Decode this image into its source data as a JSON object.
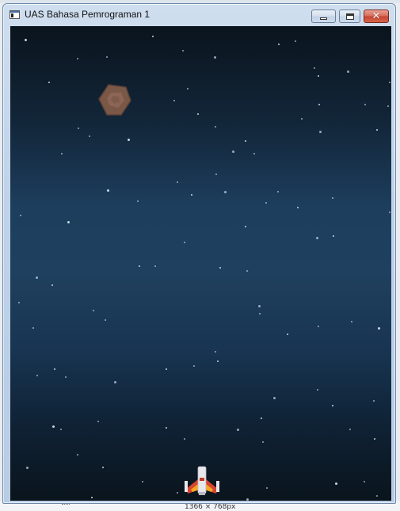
{
  "window": {
    "title": "UAS Bahasa Pemrograman 1",
    "controls": [
      "minimize",
      "maximize",
      "close"
    ]
  },
  "background_status": "1366 × 768px",
  "game": {
    "background": "starfield-gradient",
    "objects": [
      {
        "name": "asteroid",
        "icon": "asteroid-icon",
        "color": "#7a5848"
      },
      {
        "name": "player-spaceship",
        "icon": "spaceship-icon",
        "colors": [
          "#e8e8ec",
          "#d6452d",
          "#f5a623"
        ]
      }
    ]
  },
  "colors": {
    "sky_top": "#0a141d",
    "sky_mid": "#1f405e",
    "star": "#cfe0ee",
    "close_button": "#c44530"
  }
}
